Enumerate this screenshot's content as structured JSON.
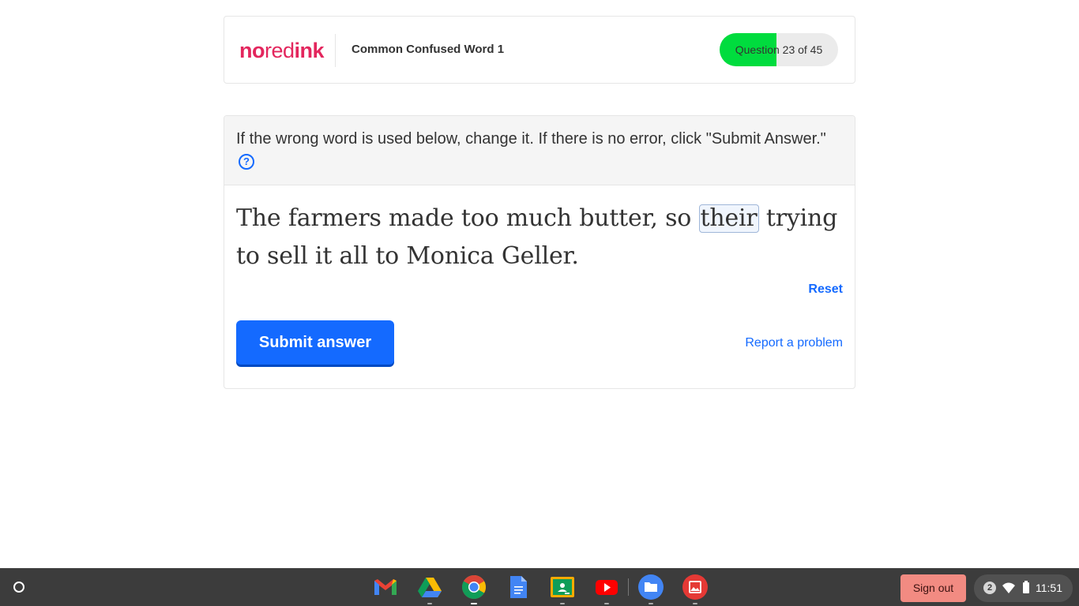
{
  "header": {
    "logo": {
      "no": "no",
      "red": "red",
      "ink": "ink"
    },
    "topic_title": "Common Confused Word 1",
    "progress": {
      "label": "Question 23 of 45",
      "current": 23,
      "total": 45,
      "fill_fraction": 0.48
    }
  },
  "question": {
    "instructions": "If the wrong word is used below, change it. If there is no error, click \"Submit Answer.\"",
    "help_icon": "?",
    "sentence_before": "The farmers made too much butter, so ",
    "highlighted_word": "their",
    "sentence_after": " trying to sell it all to Monica Geller.",
    "reset_label": "Reset",
    "submit_label": "Submit answer",
    "report_label": "Report a problem"
  },
  "shelf": {
    "apps": [
      "gmail-icon",
      "google-drive-icon",
      "chrome-icon",
      "google-docs-icon",
      "google-classroom-icon",
      "youtube-icon",
      "files-icon",
      "gallery-icon"
    ],
    "signout_label": "Sign out",
    "notification_count": "2",
    "clock": "11:51"
  },
  "colors": {
    "brand": "#e3265d",
    "primary": "#146aff",
    "progress": "#00dc3e",
    "signout": "#f28b82"
  }
}
